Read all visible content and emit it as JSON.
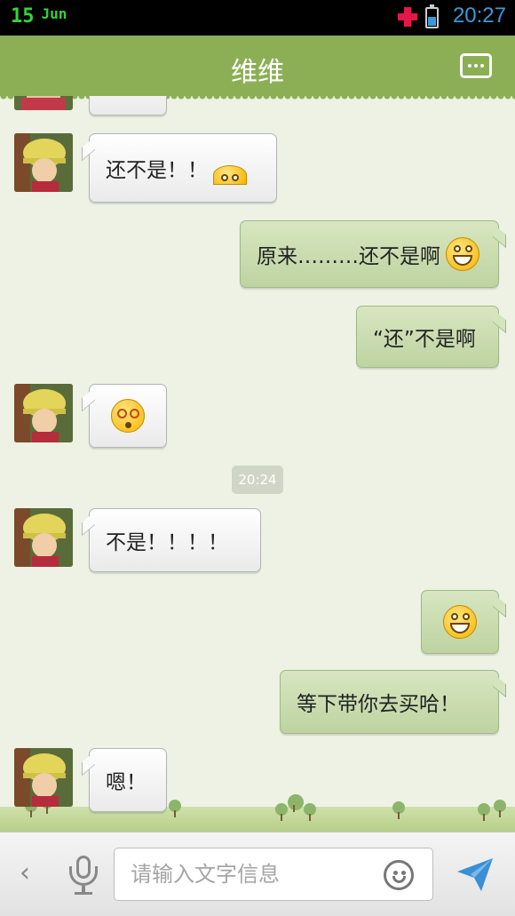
{
  "status_bar": {
    "day": "15",
    "month": "Jun",
    "time": "20:27"
  },
  "header": {
    "title": "维维"
  },
  "messages": [
    {
      "direction": "in",
      "text": "还不是！！",
      "emoji": "lip-bite-smiley"
    },
    {
      "direction": "out",
      "text": "原来………还不是啊",
      "emoji": "grin-smiley"
    },
    {
      "direction": "out",
      "text": "“还”不是啊",
      "emoji": ""
    },
    {
      "direction": "in",
      "text": "",
      "emoji": "dizzy-smiley"
    },
    {
      "direction": "in",
      "text": "不是！！！！",
      "emoji": ""
    },
    {
      "direction": "out",
      "text": "",
      "emoji": "grin-smiley"
    },
    {
      "direction": "out",
      "text": "等下带你去买哈！",
      "emoji": ""
    },
    {
      "direction": "in",
      "text": "嗯！",
      "emoji": ""
    }
  ],
  "timestamp": "20:24",
  "input": {
    "placeholder": "请输入文字信息"
  },
  "colors": {
    "header": "#8caf55",
    "incoming_bubble": "#ffffff",
    "outgoing_bubble": "#c6d9ab",
    "time_text": "#3a9ad9",
    "send_icon": "#3a8fd6"
  }
}
